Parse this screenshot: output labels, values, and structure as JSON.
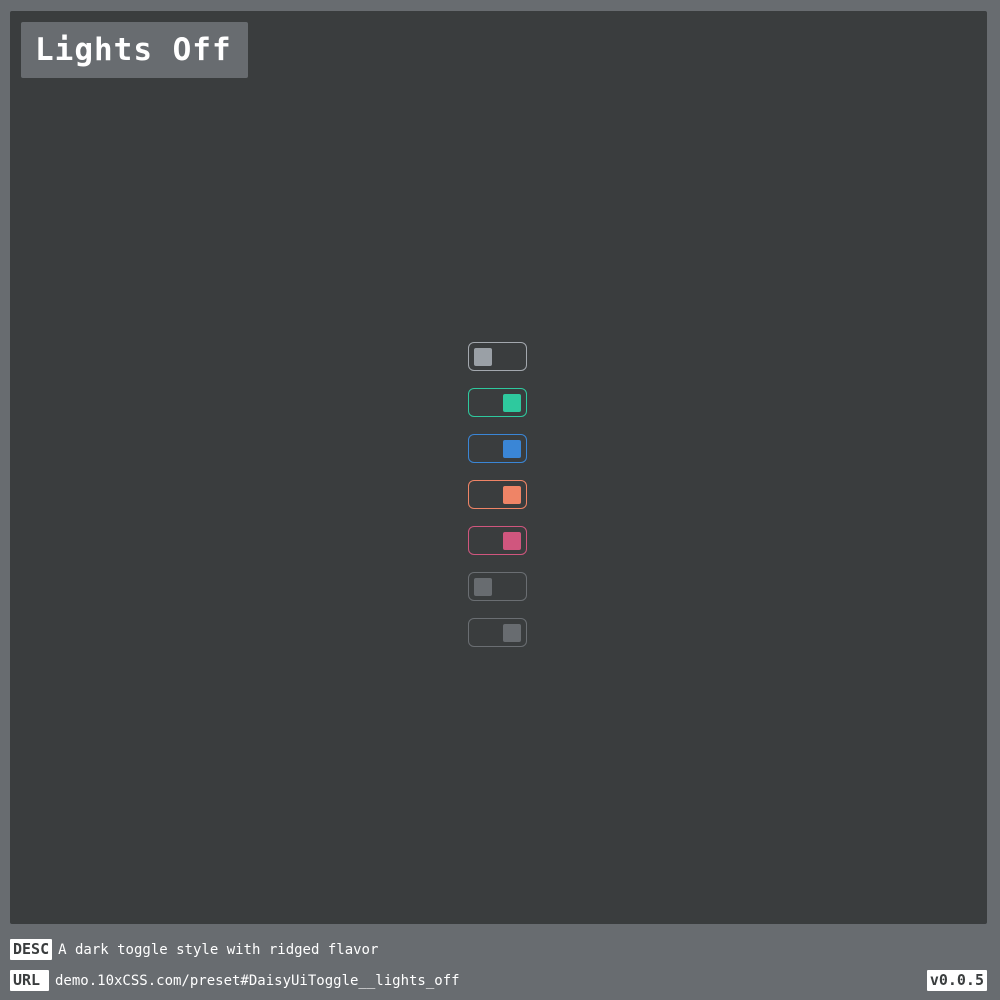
{
  "title": "Lights Off",
  "toggles": [
    {
      "name": "toggle-neutral",
      "checked": false,
      "border_color": "#a3a8ae",
      "knob_color": "#9aa0a6"
    },
    {
      "name": "toggle-success",
      "checked": true,
      "border_color": "#2ec99e",
      "knob_color": "#2ec99e"
    },
    {
      "name": "toggle-info",
      "checked": true,
      "border_color": "#3a86d6",
      "knob_color": "#3a86d6"
    },
    {
      "name": "toggle-warning",
      "checked": true,
      "border_color": "#ef8466",
      "knob_color": "#ef8466"
    },
    {
      "name": "toggle-error",
      "checked": true,
      "border_color": "#d0567e",
      "knob_color": "#d0567e"
    },
    {
      "name": "toggle-disabled-off",
      "checked": false,
      "border_color": "#6a6e72",
      "knob_color": "#686c70"
    },
    {
      "name": "toggle-disabled-on",
      "checked": true,
      "border_color": "#6a6e72",
      "knob_color": "#686c70"
    }
  ],
  "footer": {
    "desc_label": "DESC",
    "desc_text": "A dark toggle style with ridged flavor",
    "url_label": "URL",
    "url_text": "demo.10xCSS.com/preset#DaisyUiToggle__lights_off",
    "version": "v0.0.5"
  },
  "colors": {
    "page_background": "#686c70",
    "stage_background": "#3a3d3e",
    "text": "#ffffff"
  }
}
